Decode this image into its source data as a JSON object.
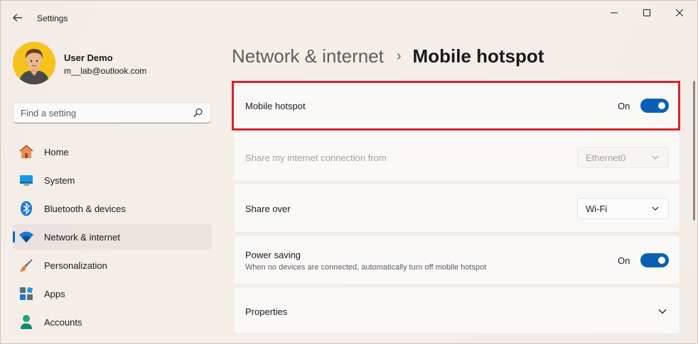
{
  "window": {
    "title": "Settings",
    "controls": [
      "minimize",
      "maximize",
      "close"
    ]
  },
  "user": {
    "name": "User Demo",
    "email": "m__lab@outlook.com"
  },
  "search": {
    "placeholder": "Find a setting"
  },
  "sidebar": {
    "items": [
      {
        "label": "Home",
        "icon": "home-icon",
        "active": false
      },
      {
        "label": "System",
        "icon": "system-icon",
        "active": false
      },
      {
        "label": "Bluetooth & devices",
        "icon": "bluetooth-icon",
        "active": false
      },
      {
        "label": "Network & internet",
        "icon": "wifi-icon",
        "active": true
      },
      {
        "label": "Personalization",
        "icon": "brush-icon",
        "active": false
      },
      {
        "label": "Apps",
        "icon": "apps-icon",
        "active": false
      },
      {
        "label": "Accounts",
        "icon": "person-icon",
        "active": false
      }
    ]
  },
  "breadcrumb": {
    "parent": "Network & internet",
    "separator": "›",
    "current": "Mobile hotspot"
  },
  "settings": {
    "mobile_hotspot": {
      "label": "Mobile hotspot",
      "state": "On"
    },
    "share_from": {
      "label": "Share my internet connection from",
      "value": "Ethernet0",
      "disabled": true
    },
    "share_over": {
      "label": "Share over",
      "value": "Wi-Fi"
    },
    "power_saving": {
      "label": "Power saving",
      "description": "When no devices are connected, automatically turn off mobile hotspot",
      "state": "On"
    },
    "properties": {
      "label": "Properties"
    }
  },
  "colors": {
    "accent": "#0a5fb4",
    "highlight_border": "#d6232d"
  }
}
